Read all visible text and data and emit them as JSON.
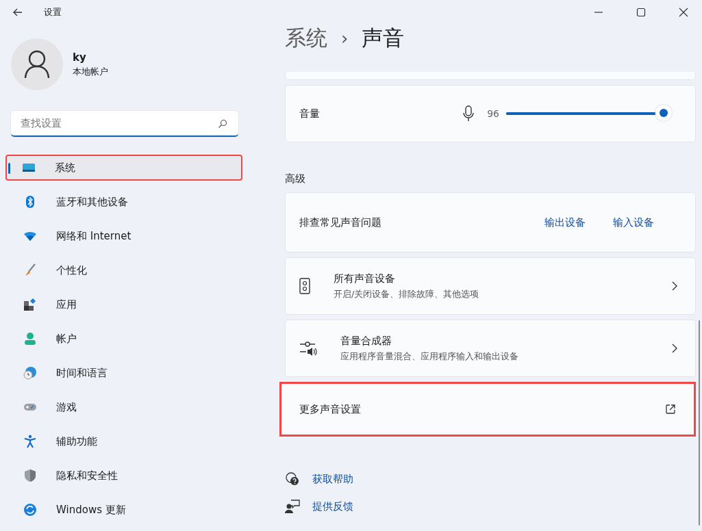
{
  "window": {
    "title": "设置"
  },
  "account": {
    "name": "ky",
    "type": "本地帐户"
  },
  "search": {
    "placeholder": "查找设置"
  },
  "sidebar": {
    "items": [
      {
        "label": "系统",
        "selected": true,
        "highlighted": true
      },
      {
        "label": "蓝牙和其他设备",
        "selected": false,
        "highlighted": false
      },
      {
        "label": "网络和 Internet",
        "selected": false,
        "highlighted": false
      },
      {
        "label": "个性化",
        "selected": false,
        "highlighted": false
      },
      {
        "label": "应用",
        "selected": false,
        "highlighted": false
      },
      {
        "label": "帐户",
        "selected": false,
        "highlighted": false
      },
      {
        "label": "时间和语言",
        "selected": false,
        "highlighted": false
      },
      {
        "label": "游戏",
        "selected": false,
        "highlighted": false
      },
      {
        "label": "辅助功能",
        "selected": false,
        "highlighted": false
      },
      {
        "label": "隐私和安全性",
        "selected": false,
        "highlighted": false
      },
      {
        "label": "Windows 更新",
        "selected": false,
        "highlighted": false
      }
    ]
  },
  "breadcrumb": {
    "parent": "系统",
    "separator": "›",
    "current": "声音"
  },
  "volume": {
    "label": "音量",
    "reading": "96",
    "level": 0.95
  },
  "advanced": {
    "heading": "高级",
    "troubleshoot": {
      "label": "排查常见声音问题",
      "links": [
        "输出设备",
        "输入设备"
      ]
    },
    "items": [
      {
        "kind": "nav",
        "title": "所有声音设备",
        "subtitle": "开启/关闭设备、排除故障、其他选项",
        "highlighted": false
      },
      {
        "kind": "nav",
        "title": "音量合成器",
        "subtitle": "应用程序音量混合、应用程序输入和输出设备",
        "highlighted": false
      },
      {
        "kind": "external",
        "title": "更多声音设置",
        "highlighted": true
      }
    ]
  },
  "footer_links": [
    "获取帮助",
    "提供反馈"
  ]
}
